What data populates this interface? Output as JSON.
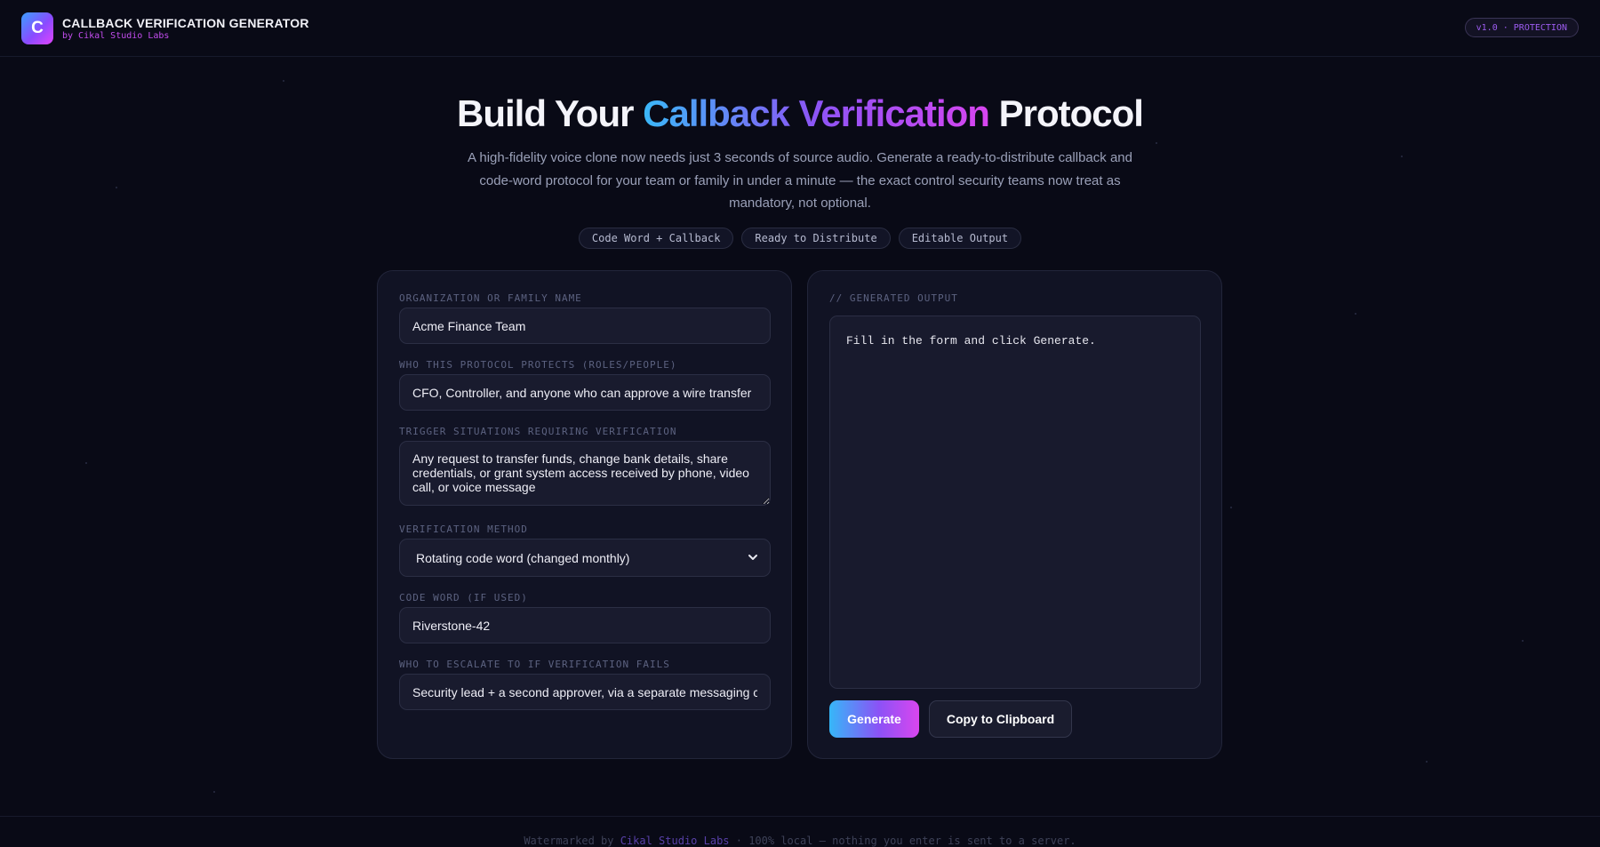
{
  "header": {
    "logo_letter": "C",
    "title": "CALLBACK VERIFICATION GENERATOR",
    "subtitle": "by Cikal Studio Labs",
    "version": "v1.0 · PROTECTION"
  },
  "hero": {
    "title_start": "Build Your ",
    "title_highlight": "Callback Verification",
    "title_end": " Protocol",
    "description": "A high-fidelity voice clone now needs just 3 seconds of source audio. Generate a ready-to-distribute callback and code-word protocol for your team or family in under a minute — the exact control security teams now treat as mandatory, not optional.",
    "chips": [
      "Code Word + Callback",
      "Ready to Distribute",
      "Editable Output"
    ]
  },
  "form": {
    "org_label": "ORGANIZATION OR FAMILY NAME",
    "org_value": "Acme Finance Team",
    "protects_label": "WHO THIS PROTOCOL PROTECTS (ROLES/PEOPLE)",
    "protects_value": "CFO, Controller, and anyone who can approve a wire transfer",
    "triggers_label": "TRIGGER SITUATIONS REQUIRING VERIFICATION",
    "triggers_value": "Any request to transfer funds, change bank details, share credentials, or grant system access received by phone, video call, or voice message",
    "method_label": "VERIFICATION METHOD",
    "method_value": "Rotating code word (changed monthly)",
    "codeword_label": "CODE WORD (IF USED)",
    "codeword_value": "Riverstone-42",
    "escalate_label": "WHO TO ESCALATE TO IF VERIFICATION FAILS",
    "escalate_value": "Security lead + a second approver, via a separate messaging channel"
  },
  "output": {
    "label": "// GENERATED OUTPUT",
    "text": "Fill in the form and click Generate.",
    "generate_label": "Generate",
    "copy_label": "Copy to Clipboard"
  },
  "footer": {
    "prefix": "Watermarked by ",
    "brand": "Cikal Studio Labs",
    "suffix": " · 100% local — nothing you enter is sent to a server."
  },
  "colors": {
    "background": "#090a16",
    "accent_blue": "#3ab8f8",
    "accent_purple": "#8d54f5",
    "accent_pink": "#d845f0"
  }
}
